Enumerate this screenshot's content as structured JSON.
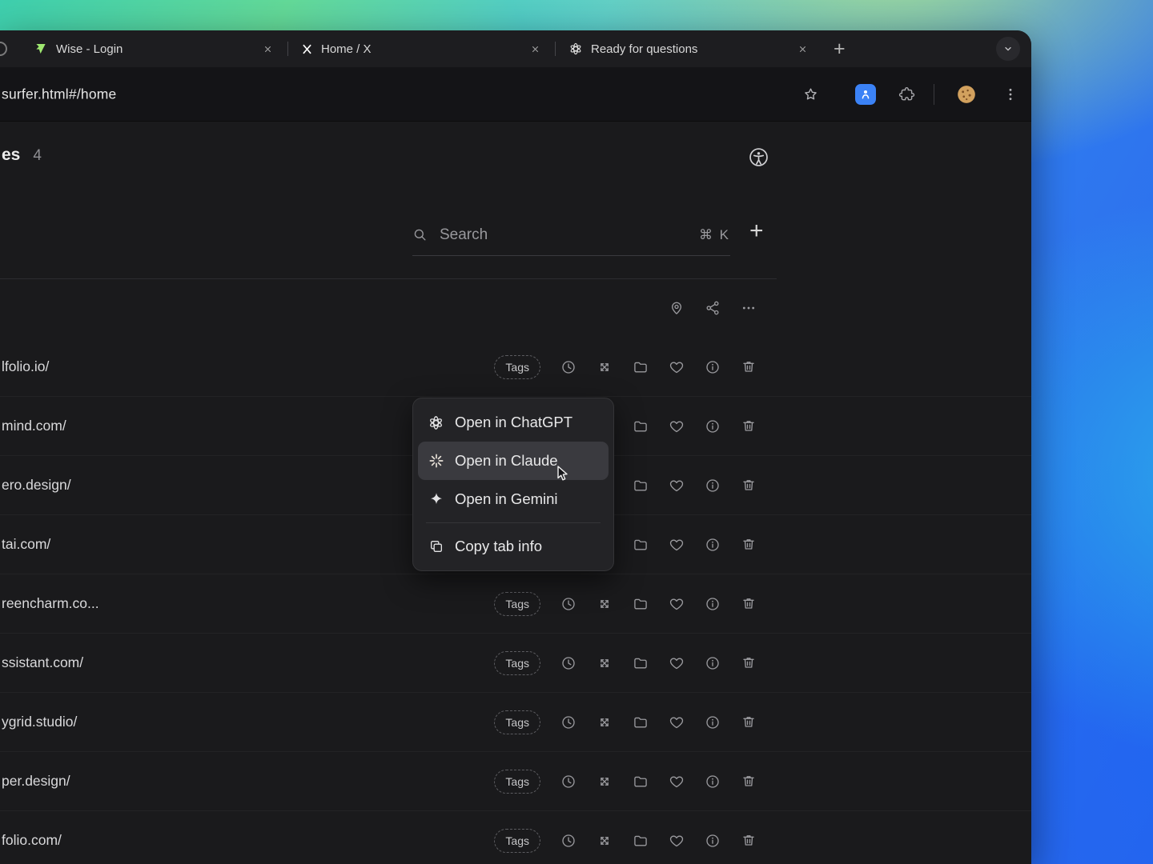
{
  "window": {
    "tabstrip": {
      "tabs": [
        {
          "title": "Wise - Login",
          "favicon": "wise-flag-icon"
        },
        {
          "title": "Home / X",
          "favicon": "x-logo-icon"
        },
        {
          "title": "Ready for questions",
          "favicon": "openai-logo-icon"
        }
      ],
      "new_tab_button": "+"
    },
    "toolbar": {
      "url": "surfer.html#/home"
    }
  },
  "page": {
    "header": {
      "title_partial": "es",
      "count": "4"
    },
    "search": {
      "placeholder": "Search",
      "shortcut": "⌘ K"
    },
    "add_button": "+",
    "row_actions": {
      "tags_label": "Tags"
    },
    "rows": [
      {
        "url": "lfolio.io/"
      },
      {
        "url": "mind.com/"
      },
      {
        "url": "ero.design/"
      },
      {
        "url": "tai.com/"
      },
      {
        "url": "reencharm.co..."
      },
      {
        "url": "ssistant.com/"
      },
      {
        "url": "ygrid.studio/"
      },
      {
        "url": "per.design/"
      },
      {
        "url": "folio.com/"
      }
    ],
    "context_menu": {
      "items": [
        {
          "label": "Open in ChatGPT",
          "icon": "openai-logo-icon"
        },
        {
          "label": "Open in Claude",
          "icon": "claude-logo-icon",
          "highlighted": true
        },
        {
          "label": "Open in Gemini",
          "icon": "gemini-logo-icon"
        },
        {
          "label": "Copy tab info",
          "icon": "copy-icon"
        }
      ]
    }
  },
  "colors": {
    "background_gradient": [
      "#3ecfae",
      "#63d998",
      "#4cc9d6",
      "#2f7cf0",
      "#2a63ea"
    ],
    "window_background": "#1a1a1c",
    "wise_green": "#9fe870",
    "extension_blue": "#3b82f6",
    "cookie_brown": "#d2a15e",
    "menu_highlight": "#3a3a3f"
  }
}
